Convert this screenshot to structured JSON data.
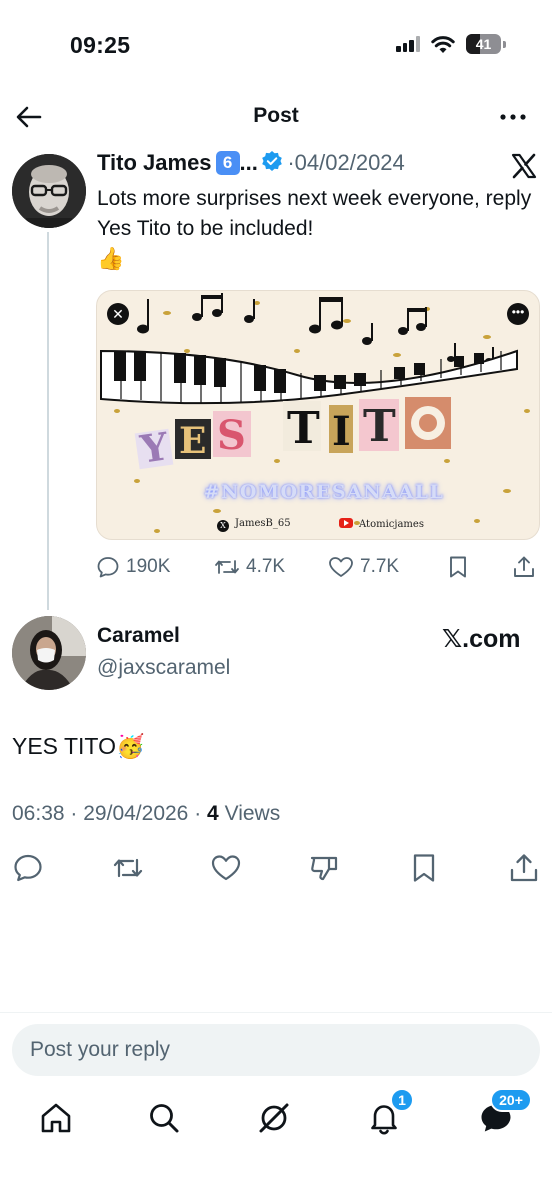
{
  "status_bar": {
    "time": "09:25",
    "battery_level": "41",
    "battery_fraction": 0.41
  },
  "header": {
    "title": "Post",
    "back_icon": "arrow-left-icon",
    "more_icon": "more-horizontal-icon"
  },
  "parent_post": {
    "author_name": "Tito James",
    "badge": "6",
    "ellipsis": "...",
    "separator": "·",
    "date": "04/02/2024",
    "text": "Lots more surprises next week everyone, reply Yes Tito to be included!",
    "emoji": "👍",
    "media": {
      "headline": "YES TITO",
      "hashtag": "#NOMORESANAALL",
      "credit_x": "JamesB_65",
      "credit_youtube": "Atomicjames"
    },
    "stats": {
      "replies": "190K",
      "reposts": "4.7K",
      "likes": "7.7K"
    }
  },
  "reply": {
    "author_name": "Caramel",
    "handle": "@jaxscaramel",
    "source_label": "𝕏.com",
    "text": "YES TITO",
    "emoji": "🥳",
    "time": "06:38",
    "date": "29/04/2026",
    "views_count": "4",
    "views_label": "Views",
    "sep": "·"
  },
  "composer": {
    "placeholder": "Post your reply"
  },
  "bottom_nav": {
    "notifications_badge": "1",
    "messages_badge": "20+"
  },
  "colors": {
    "text": "#0f1419",
    "secondary": "#536471",
    "accent": "#1d9bf0",
    "verified": "#1d9bf0"
  }
}
